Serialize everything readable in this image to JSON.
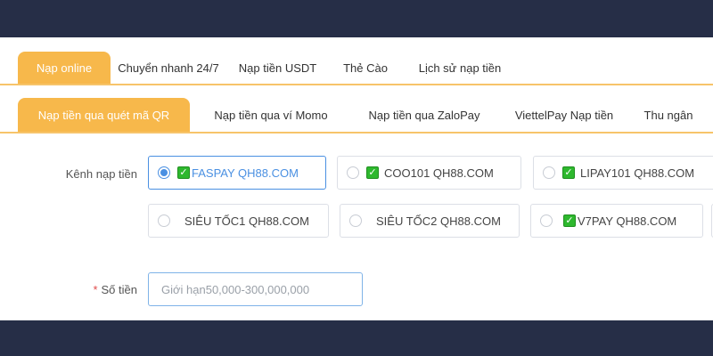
{
  "top_tabs": [
    {
      "label": "Nạp online",
      "active": true
    },
    {
      "label": "Chuyển nhanh 24/7",
      "active": false
    },
    {
      "label": "Nạp tiền USDT",
      "active": false
    },
    {
      "label": "Thẻ Cào",
      "active": false
    },
    {
      "label": "Lịch sử nạp tiền",
      "active": false
    }
  ],
  "sub_tabs": [
    {
      "label": "Nạp tiền qua quét mã QR",
      "active": true
    },
    {
      "label": "Nạp tiền qua ví Momo",
      "active": false
    },
    {
      "label": "Nạp tiền qua ZaloPay",
      "active": false
    },
    {
      "label": "ViettelPay Nạp tiền",
      "active": false
    },
    {
      "label": "Thu ngân",
      "active": false
    }
  ],
  "channel_label": "Kênh nạp tiền",
  "channels": [
    {
      "name": "FASPAY QH88.COM",
      "selected": true,
      "checked": true
    },
    {
      "name": "COO101 QH88.COM",
      "selected": false,
      "checked": true
    },
    {
      "name": "LIPAY101 QH88.COM",
      "selected": false,
      "checked": true
    },
    {
      "name": "SIÊU TỐC1 QH88.COM",
      "selected": false,
      "checked": false
    },
    {
      "name": "SIÊU TỐC2 QH88.COM",
      "selected": false,
      "checked": false
    },
    {
      "name": "V7PAY QH88.COM",
      "selected": false,
      "checked": true
    }
  ],
  "amount": {
    "required_mark": "*",
    "label": "Số tiền",
    "placeholder": "Giới hạn50,000-300,000,000",
    "value": ""
  },
  "colors": {
    "accent": "#f7b84b",
    "selected": "#4a90e2",
    "background": "#262e47"
  },
  "icons": {
    "check": "green-checkmark-icon",
    "radio": "radio-icon"
  }
}
